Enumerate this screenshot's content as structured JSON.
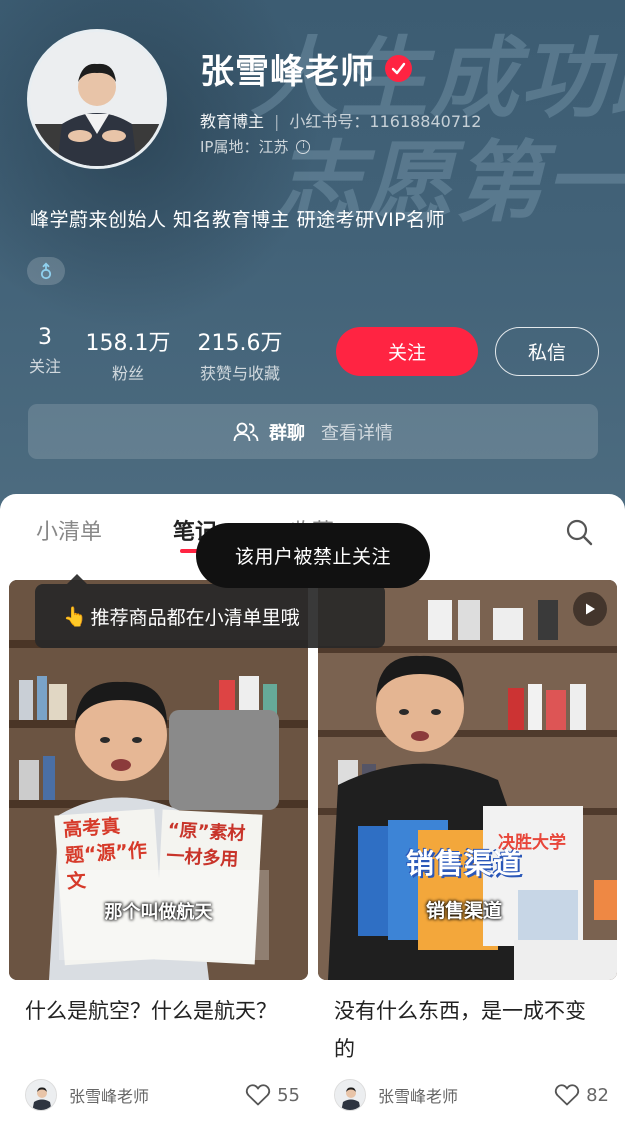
{
  "profile": {
    "nickname": "张雪峰老师",
    "category": "教育博主",
    "xhs_id": "小红书号：11618840712",
    "ip_location": "IP属地：江苏",
    "bio": "峰学蔚来创始人 知名教育博主 研途考研VIP名师",
    "gender": "male"
  },
  "background": {
    "line1": "人生成功路",
    "line2": "志愿第一步"
  },
  "stats": [
    {
      "num": "3",
      "label": "关注"
    },
    {
      "num": "158.1万",
      "label": "粉丝"
    },
    {
      "num": "215.6万",
      "label": "获赞与收藏"
    }
  ],
  "actions": {
    "follow": "关注",
    "message": "私信"
  },
  "group_chat": {
    "label": "群聊",
    "detail": "查看详情"
  },
  "tabs": [
    {
      "label": "小清单",
      "active": false
    },
    {
      "label": "笔记",
      "active": true
    },
    {
      "label": "收藏",
      "active": false
    }
  ],
  "toasts": {
    "blocked": "该用户被禁止关注",
    "tip": "推荐商品都在小清单里哦"
  },
  "notes": [
    {
      "title": "什么是航空？什么是航天？",
      "author": "张雪峰老师",
      "likes": "55",
      "book_left_title": "高考真题“源”作文",
      "book_right_title": "“原”素材一材多用",
      "subtitle": "那个叫做航天"
    },
    {
      "title": "没有什么东西，是一成不变的",
      "author": "张雪峰老师",
      "likes": "82",
      "overlay": "销售渠道",
      "subtitle": "销售渠道",
      "book_right_title": "决胜大学"
    }
  ],
  "colors": {
    "accent": "#ff2442",
    "header_bg": "#426278"
  },
  "icons": [
    "verified-icon",
    "info-icon",
    "male-icon",
    "group-chat-icon",
    "search-icon",
    "pointing-hand-icon",
    "play-icon",
    "heart-icon"
  ]
}
